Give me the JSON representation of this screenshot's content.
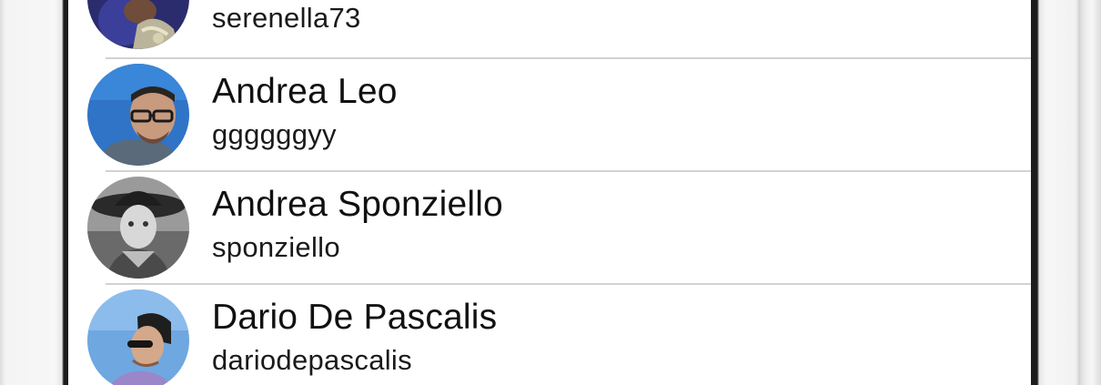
{
  "contacts": [
    {
      "name": "",
      "handle": "serenella73",
      "avatar_icon": "avatar-photo-serenella73"
    },
    {
      "name": "Andrea Leo",
      "handle": "ggggggyy",
      "avatar_icon": "avatar-photo-man-glasses-blue-background"
    },
    {
      "name": "Andrea Sponziello",
      "handle": "sponziello",
      "avatar_icon": "avatar-photo-child-cowboy-hat-bw"
    },
    {
      "name": "Dario De Pascalis",
      "handle": "dariodepascalis",
      "avatar_icon": "avatar-photo-man-sunglasses-beanie"
    }
  ],
  "colors": {
    "screen_background": "#ffffff",
    "separator": "#d2d2d2",
    "text": "#111111",
    "device_bezel": "#1c1c1c",
    "device_body": "#f4f4f4"
  }
}
